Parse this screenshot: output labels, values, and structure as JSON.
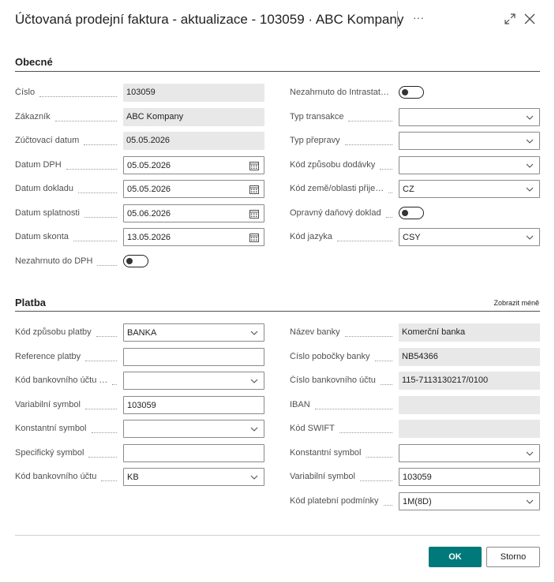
{
  "window": {
    "title": "Účtovaná prodejní faktura - aktualizace - 103059 · ABC Kompany",
    "more_label": "···"
  },
  "general": {
    "section_title": "Obecné",
    "left": [
      {
        "label": "Číslo",
        "value": "103059",
        "kind": "ro"
      },
      {
        "label": "Zákazník",
        "value": "ABC Kompany",
        "kind": "ro"
      },
      {
        "label": "Zúčtovací datum",
        "value": "05.05.2026",
        "kind": "ro"
      },
      {
        "label": "Datum DPH",
        "value": "05.05.2026",
        "kind": "date"
      },
      {
        "label": "Datum dokladu",
        "value": "05.05.2026",
        "kind": "date"
      },
      {
        "label": "Datum splatnosti",
        "value": "05.06.2026",
        "kind": "date"
      },
      {
        "label": "Datum skonta",
        "value": "13.05.2026",
        "kind": "date"
      },
      {
        "label": "Nezahrnuto do DPH",
        "value": "",
        "kind": "toggle"
      }
    ],
    "right": [
      {
        "label": "Nezahrnuto do Intrastat…",
        "value": "",
        "kind": "toggle"
      },
      {
        "label": "Typ transakce",
        "value": "",
        "kind": "select"
      },
      {
        "label": "Typ přepravy",
        "value": "",
        "kind": "select"
      },
      {
        "label": "Kód způsobu dodávky",
        "value": "",
        "kind": "select"
      },
      {
        "label": "Kód země/oblasti přije…",
        "value": "CZ",
        "kind": "select"
      },
      {
        "label": "Opravný daňový doklad",
        "value": "",
        "kind": "toggle"
      },
      {
        "label": "Kód jazyka",
        "value": "CSY",
        "kind": "select"
      }
    ]
  },
  "payment": {
    "section_title": "Platba",
    "show_less": "Zobrazit méně",
    "left": [
      {
        "label": "Kód způsobu platby",
        "value": "BANKA",
        "kind": "select"
      },
      {
        "label": "Reference platby",
        "value": "",
        "kind": "text"
      },
      {
        "label": "Kód bankovního účtu …",
        "value": "",
        "kind": "select"
      },
      {
        "label": "Variabilní symbol",
        "value": "103059",
        "kind": "text"
      },
      {
        "label": "Konstantní symbol",
        "value": "",
        "kind": "select"
      },
      {
        "label": "Specifický symbol",
        "value": "",
        "kind": "text"
      },
      {
        "label": "Kód bankovního účtu",
        "value": "KB",
        "kind": "select"
      }
    ],
    "right": [
      {
        "label": "Název banky",
        "value": "Komerční banka",
        "kind": "ro"
      },
      {
        "label": "Číslo pobočky banky",
        "value": "NB54366",
        "kind": "ro"
      },
      {
        "label": "Číslo bankovního účtu",
        "value": "115-7113130217/0100",
        "kind": "ro"
      },
      {
        "label": "IBAN",
        "value": "",
        "kind": "ro"
      },
      {
        "label": "Kód SWIFT",
        "value": "",
        "kind": "ro"
      },
      {
        "label": "Konstantní symbol",
        "value": "",
        "kind": "select"
      },
      {
        "label": "Variabilní symbol",
        "value": "103059",
        "kind": "text"
      },
      {
        "label": "Kód platební podmínky",
        "value": "1M(8D)",
        "kind": "select"
      }
    ]
  },
  "buttons": {
    "ok": "OK",
    "cancel": "Storno"
  }
}
